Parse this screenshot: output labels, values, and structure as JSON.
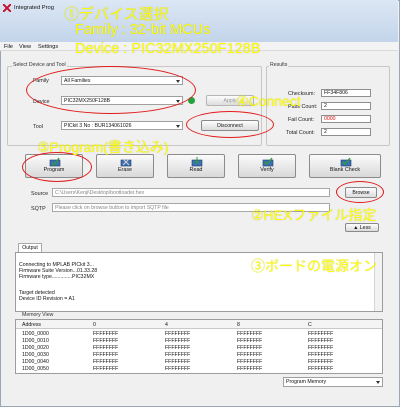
{
  "window": {
    "title": "Integrated Prog"
  },
  "menu": [
    "File",
    "View",
    "Settings"
  ],
  "device_group": {
    "label": "Select Device and Tool",
    "family_label": "Family",
    "family_value": "All Families",
    "device_label": "Device",
    "device_value": "PIC32MX250F128B",
    "apply_label": "Apply",
    "tool_label": "Tool",
    "tool_value": "PICkit 3 No : BUR134061026",
    "disconnect_label": "Disconnect"
  },
  "results": {
    "label": "Results",
    "checksum_label": "Checksum:",
    "checksum_value": "FF34F806",
    "pass_label": "Pass Count:",
    "pass_value": "2",
    "fail_label": "Fail Count:",
    "fail_value": "0000",
    "total_label": "Total Count:",
    "total_value": "2"
  },
  "actions": {
    "program": "Program",
    "erase": "Erase",
    "read": "Read",
    "verify": "Verify",
    "blank_check": "Blank Check"
  },
  "source": {
    "source_label": "Source",
    "source_value": "C:\\Users\\Kenji\\Desktop\\bootloader.hex",
    "browse_label": "Browse",
    "sqtp_label": "SQTP",
    "sqtp_placeholder": "Please click on browse button to import SQTP file",
    "less_label": "▲ Less"
  },
  "output": {
    "tab_label": "Output",
    "lines": [
      "Connecting to MPLAB PICkit 3...",
      "Firmware Suite Version...01.33.28",
      "Firmware type..............PIC32MX",
      "",
      "Target detected",
      "Device ID Revision = A1"
    ]
  },
  "memory": {
    "label": "Memory View",
    "columns": [
      "Address",
      "0",
      "4",
      "8",
      "C"
    ],
    "rows": [
      [
        "1D00_0000",
        "FFFFFFFF",
        "FFFFFFFF",
        "FFFFFFFF",
        "FFFFFFFF"
      ],
      [
        "1D00_0010",
        "FFFFFFFF",
        "FFFFFFFF",
        "FFFFFFFF",
        "FFFFFFFF"
      ],
      [
        "1D00_0020",
        "FFFFFFFF",
        "FFFFFFFF",
        "FFFFFFFF",
        "FFFFFFFF"
      ],
      [
        "1D00_0030",
        "FFFFFFFF",
        "FFFFFFFF",
        "FFFFFFFF",
        "FFFFFFFF"
      ],
      [
        "1D00_0040",
        "FFFFFFFF",
        "FFFFFFFF",
        "FFFFFFFF",
        "FFFFFFFF"
      ],
      [
        "1D00_0050",
        "FFFFFFFF",
        "FFFFFFFF",
        "FFFFFFFF",
        "FFFFFFFF"
      ]
    ],
    "view_select": "Program Memory"
  },
  "annotations": {
    "a1": "①デバイス選択",
    "a1_family": "Family : 32-bit MCUs",
    "a1_device": "Device : PIC32MX250F128B",
    "a2": "②HEXファイル指定",
    "a3": "③ボードの電源オン",
    "a4": "④Connect",
    "a5": "⑤Program(書き込み)"
  },
  "colors": {
    "annotation": "#ffff00",
    "ellipse": "#e21b1b",
    "status_led": "#22a33a",
    "fail_value": "#d01010"
  },
  "icons": [
    "app-icon",
    "program-chip-icon",
    "erase-chip-icon",
    "read-chip-icon",
    "verify-chip-icon",
    "blank-check-chip-icon",
    "status-led-icon",
    "chevron-down-icon"
  ]
}
